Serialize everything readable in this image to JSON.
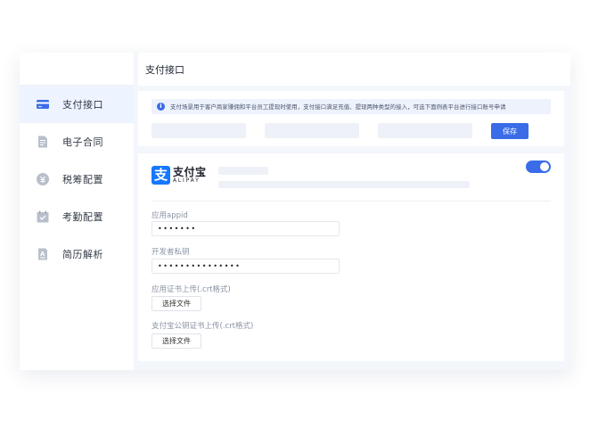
{
  "topbar": {
    "title": "支付接口"
  },
  "sidebar": {
    "items": [
      {
        "label": "支付接口",
        "icon": "card-icon",
        "active": true
      },
      {
        "label": "电子合同",
        "icon": "document-icon",
        "active": false
      },
      {
        "label": "税筹配置",
        "icon": "tax-coin-icon",
        "active": false
      },
      {
        "label": "考勤配置",
        "icon": "calendar-check-icon",
        "active": false
      },
      {
        "label": "简历解析",
        "icon": "resume-icon",
        "active": false
      }
    ]
  },
  "notice": {
    "icon": "info-icon",
    "text": "支付场景用于客户商家赚佣和平台员工提现时使用，支付接口满足充值、提现两种类型的接入，可选下面例表平台进行接口账号申请"
  },
  "toolbar": {
    "save_label": "保存"
  },
  "alipay": {
    "brand_cn": "支付宝",
    "brand_en": "ALIPAY",
    "logo_char": "支",
    "enabled": true
  },
  "form": {
    "appid": {
      "label": "应用appid",
      "value": "•••••••"
    },
    "private_key": {
      "label": "开发者私钥",
      "value": "•••••••••••••••"
    },
    "app_cert": {
      "label": "应用证书上传(.crt格式)",
      "button": "选择文件"
    },
    "alipay_cert": {
      "label": "支付宝公钥证书上传(.crt格式)",
      "button": "选择文件"
    }
  },
  "colors": {
    "accent": "#3a6ce8",
    "active_bg": "#eef4ff",
    "alipay_blue": "#1677ff"
  }
}
